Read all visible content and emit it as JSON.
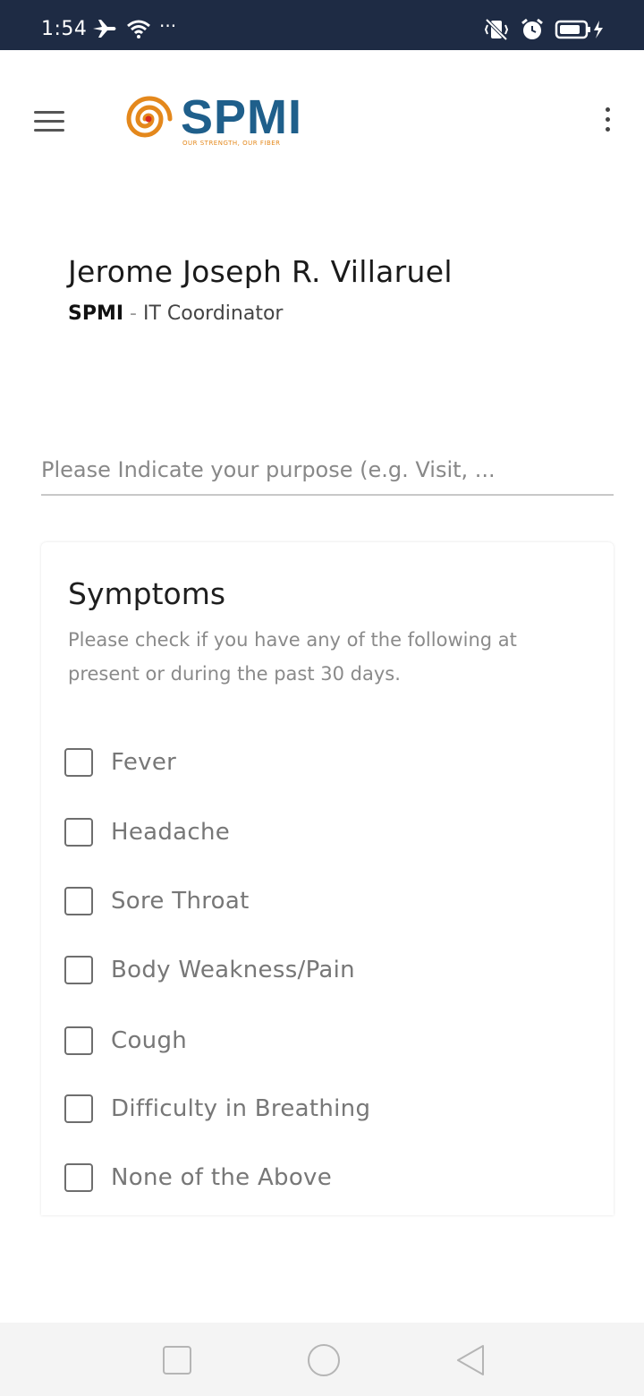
{
  "status_bar": {
    "time": "1:54",
    "left_icons": [
      "airplane-icon",
      "wifi-icon"
    ],
    "dots": "···",
    "right_icons": [
      "vibrate-icon",
      "alarm-icon",
      "battery-charging-icon"
    ]
  },
  "app_bar": {
    "logo_text": "SPMI",
    "logo_tagline": "OUR STRENGTH, OUR FIBER",
    "colors": {
      "logo_blue": "#1f5f8b",
      "logo_orange": "#e4881c"
    }
  },
  "profile": {
    "name": "Jerome Joseph R. Villaruel",
    "company": "SPMI",
    "separator": " - ",
    "role": "IT Coordinator"
  },
  "purpose": {
    "placeholder": "Please Indicate your purpose (e.g. Visit, ...",
    "value": ""
  },
  "symptoms": {
    "title": "Symptoms",
    "description": "Please check if you have any of the following at present or during the past 30 days.",
    "items": [
      {
        "label": "Fever",
        "checked": false
      },
      {
        "label": "Headache",
        "checked": false
      },
      {
        "label": "Sore Throat",
        "checked": false
      },
      {
        "label": "Body Weakness/Pain",
        "checked": false
      },
      {
        "label": "Cough",
        "checked": false
      },
      {
        "label": "Difficulty in Breathing",
        "checked": false
      },
      {
        "label": "None of the Above",
        "checked": false
      }
    ]
  },
  "nav_bar": {
    "buttons": [
      "recent-apps-icon",
      "home-icon",
      "back-icon"
    ]
  }
}
